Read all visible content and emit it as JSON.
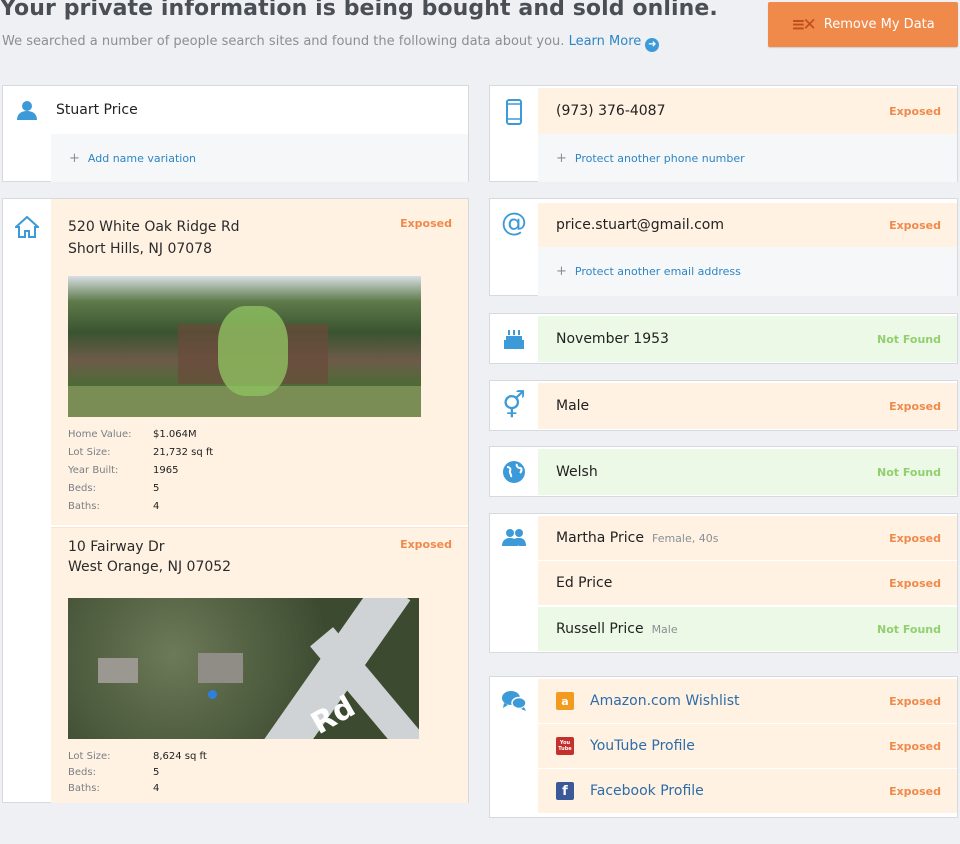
{
  "header": {
    "title": "Your private information is being bought and sold online.",
    "subtitle": "We searched a number of people search sites and found the following data about you.",
    "learn_more": "Learn More",
    "remove_button": "Remove My Data"
  },
  "name_card": {
    "name": "Stuart Price",
    "add_label": "Add name variation"
  },
  "addresses": [
    {
      "line1": "520 White Oak Ridge Rd",
      "line2": "Short Hills, NJ 07078",
      "status": "Exposed",
      "details": [
        {
          "label": "Home Value:",
          "value": "$1.064M"
        },
        {
          "label": "Lot Size:",
          "value": "21,732 sq ft"
        },
        {
          "label": "Year Built:",
          "value": "1965"
        },
        {
          "label": "Beds:",
          "value": "5"
        },
        {
          "label": "Baths:",
          "value": "4"
        }
      ]
    },
    {
      "line1": "10 Fairway Dr",
      "line2": "West Orange, NJ 07052",
      "status": "Exposed",
      "map_label": "Rd",
      "details": [
        {
          "label": "Lot Size:",
          "value": "8,624 sq ft"
        },
        {
          "label": "Beds:",
          "value": "5"
        },
        {
          "label": "Baths:",
          "value": "4"
        }
      ]
    }
  ],
  "phone": {
    "value": "(973) 376-4087",
    "status": "Exposed",
    "add_label": "Protect another phone number"
  },
  "email": {
    "value": "price.stuart@gmail.com",
    "status": "Exposed",
    "add_label": "Protect another email address"
  },
  "birthday": {
    "value": "November 1953",
    "status": "Not Found"
  },
  "gender": {
    "value": "Male",
    "status": "Exposed"
  },
  "ethnicity": {
    "value": "Welsh",
    "status": "Not Found"
  },
  "relatives": [
    {
      "name": "Martha Price",
      "detail": "Female, 40s",
      "status": "Exposed"
    },
    {
      "name": "Ed Price",
      "detail": "",
      "status": "Exposed"
    },
    {
      "name": "Russell Price",
      "detail": "Male",
      "status": "Not Found"
    }
  ],
  "social": [
    {
      "label": "Amazon.com Wishlist",
      "icon_text": "a",
      "status": "Exposed"
    },
    {
      "label": "YouTube Profile",
      "icon_text": "You Tube",
      "status": "Exposed"
    },
    {
      "label": "Facebook Profile",
      "icon_text": "f",
      "status": "Exposed"
    }
  ],
  "colors": {
    "accent": "#3d9ad8",
    "exposed": "#ef8a4c",
    "not_found": "#92cf6e",
    "button": "#f08a4b"
  }
}
